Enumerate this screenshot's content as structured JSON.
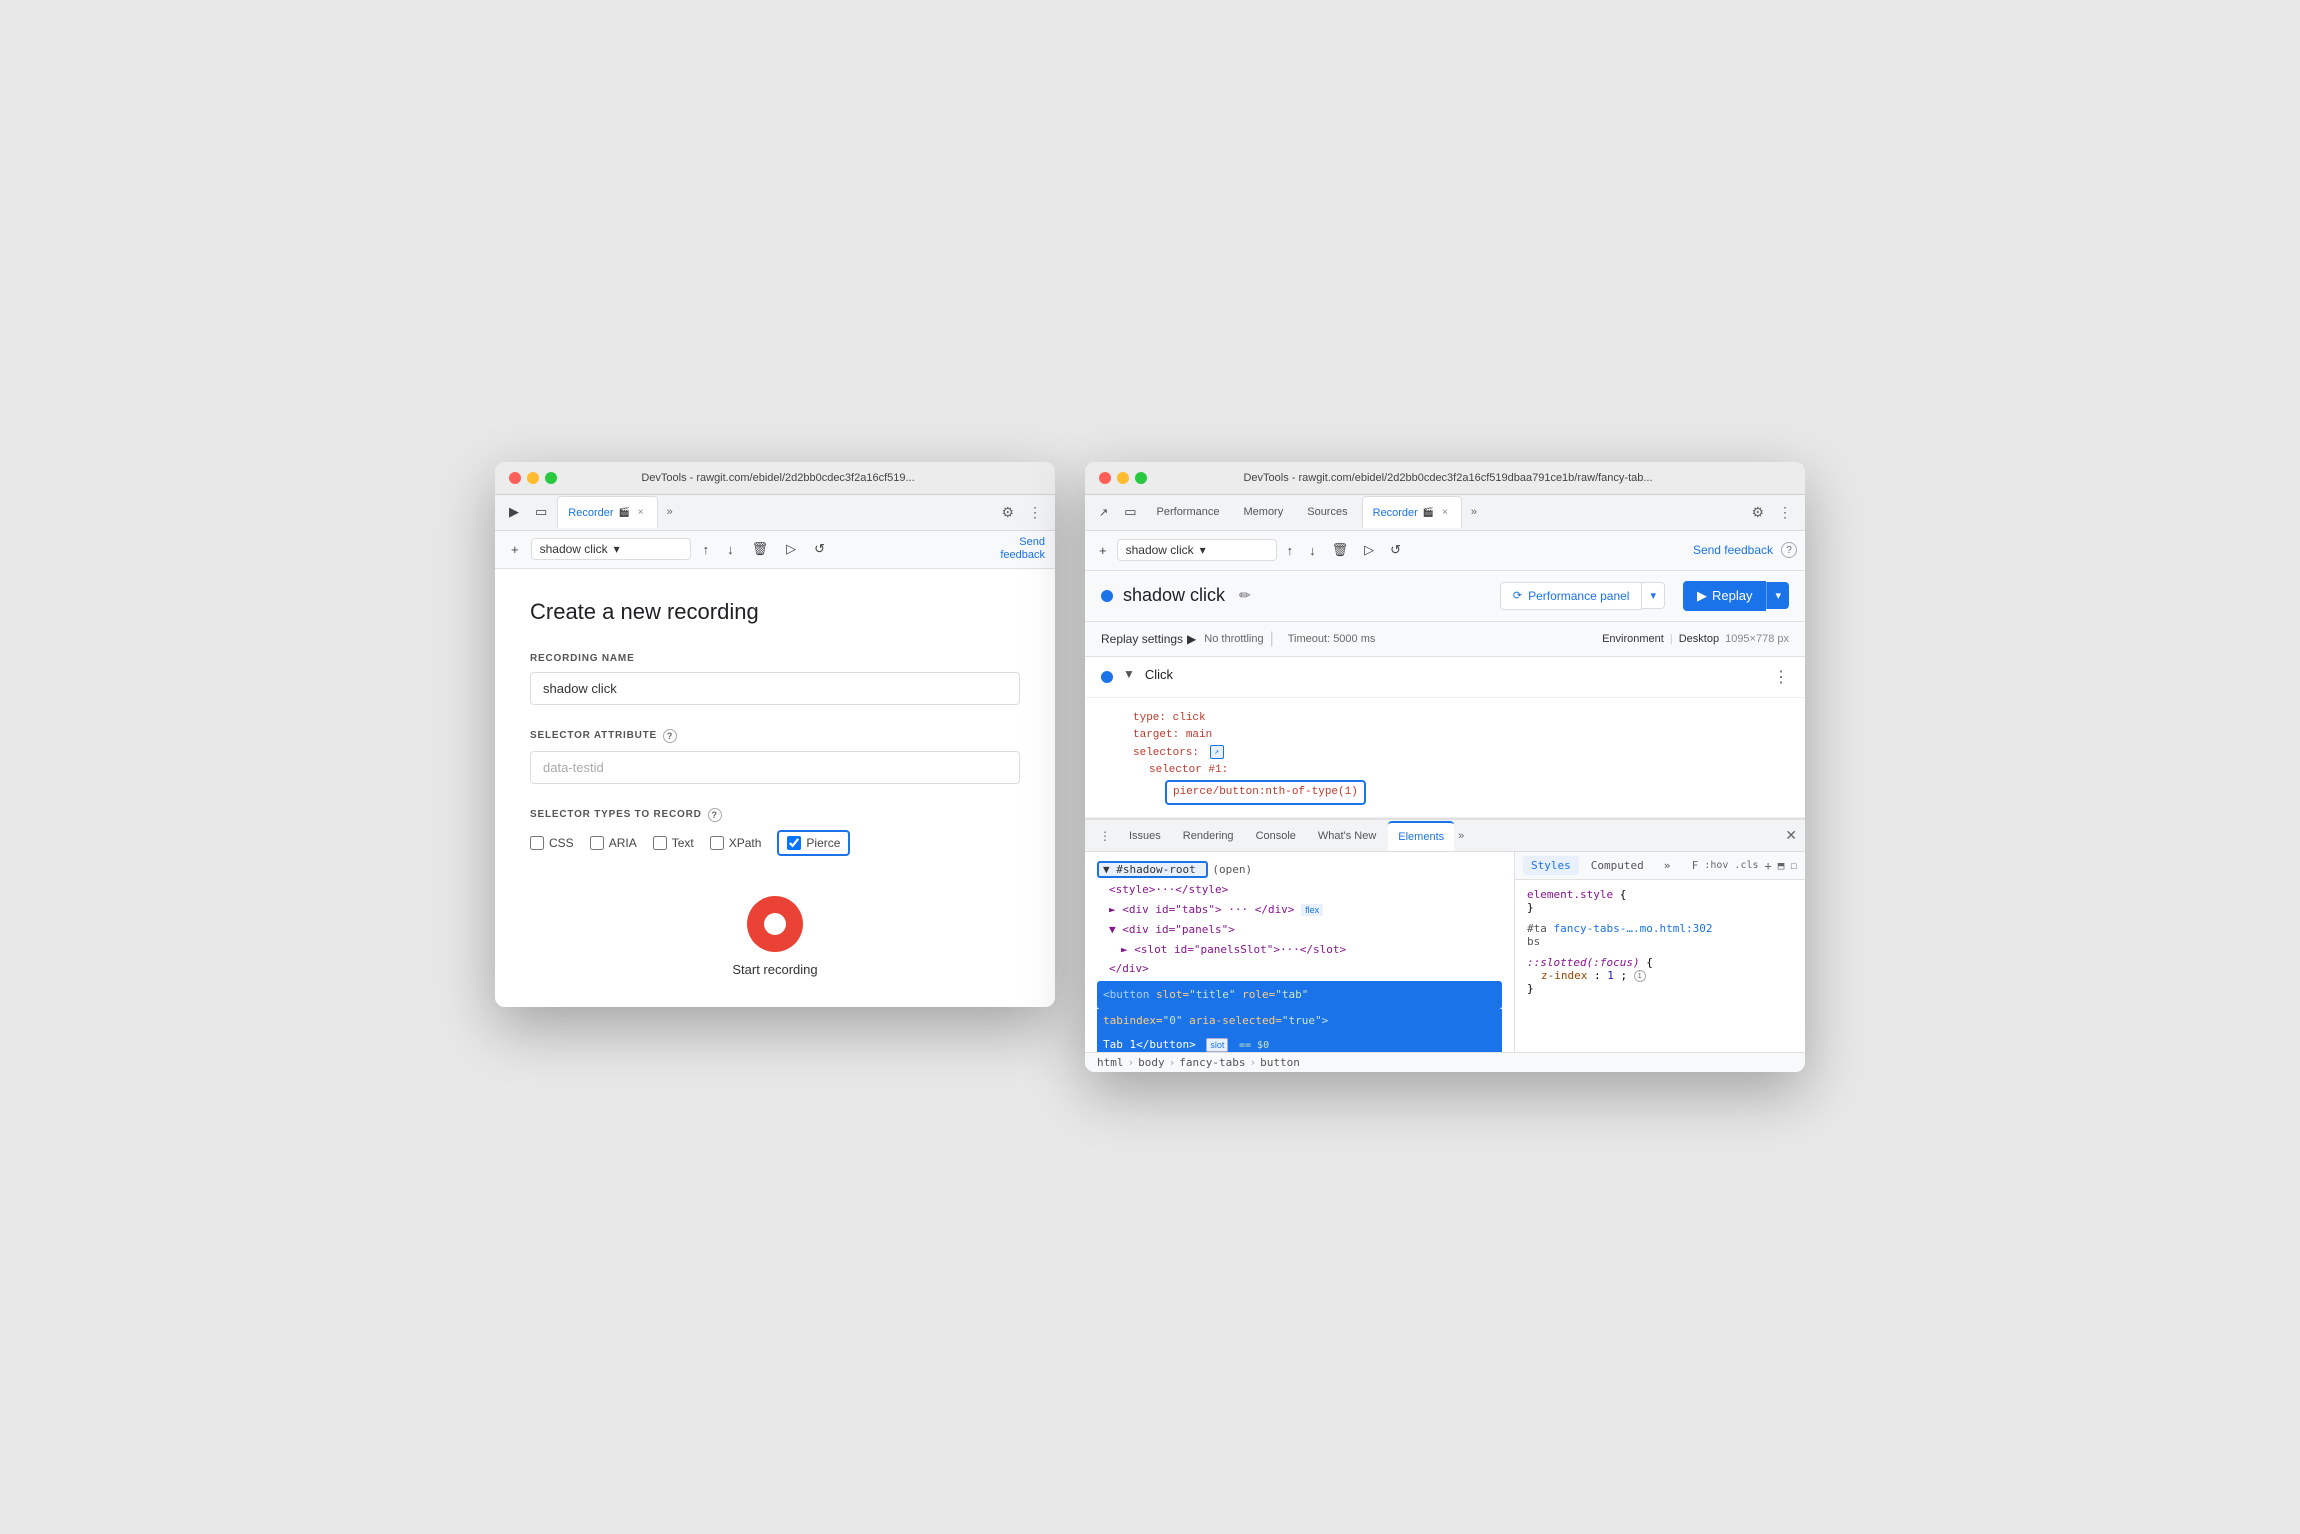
{
  "left_window": {
    "title": "DevTools - rawgit.com/ebidel/2d2bb0cdec3f2a16cf519...",
    "tab_label": "Recorder",
    "tab_close": "×",
    "toolbar": {
      "new_btn": "+",
      "recording_name": "shadow click",
      "more_btn": "»",
      "feedback": "Send\nfeedback"
    },
    "create_panel": {
      "title": "Create a new recording",
      "recording_name_label": "RECORDING NAME",
      "recording_name_value": "shadow click",
      "selector_attr_label": "SELECTOR ATTRIBUTE",
      "selector_attr_placeholder": "data-testid",
      "selector_types_label": "SELECTOR TYPES TO RECORD",
      "checkboxes": [
        {
          "label": "CSS",
          "checked": false
        },
        {
          "label": "ARIA",
          "checked": false
        },
        {
          "label": "Text",
          "checked": false
        },
        {
          "label": "XPath",
          "checked": false
        },
        {
          "label": "Pierce",
          "checked": true,
          "highlighted": true
        }
      ],
      "start_btn_label": "Start recording"
    }
  },
  "right_window": {
    "title": "DevTools - rawgit.com/ebidel/2d2bb0cdec3f2a16cf519dbaa791ce1b/raw/fancy-tab...",
    "tabs": [
      {
        "label": "Performance",
        "active": false
      },
      {
        "label": "Memory",
        "active": false
      },
      {
        "label": "Sources",
        "active": false
      },
      {
        "label": "Recorder",
        "active": true
      },
      {
        "label": "»",
        "active": false
      }
    ],
    "toolbar": {
      "new_btn": "+",
      "recording_name": "shadow click",
      "feedback_label": "Send feedback",
      "help_icon": "?"
    },
    "recorder_header": {
      "recording_title": "shadow click",
      "edit_icon": "✏",
      "perf_panel_btn": "Performance panel",
      "replay_btn": "Replay"
    },
    "replay_settings": {
      "label": "Replay settings",
      "arrow": "▶",
      "no_throttling": "No throttling",
      "timeout": "Timeout: 5000 ms",
      "env_label": "Environment",
      "env_value": "Desktop",
      "env_resolution": "1095×778 px"
    },
    "step": {
      "label": "Click",
      "code": {
        "type_key": "type:",
        "type_val": "click",
        "target_key": "target:",
        "target_val": "main",
        "selectors_key": "selectors:",
        "selector_num_label": "selector #1:",
        "selector_val": "pierce/button:nth-of-type(1)"
      }
    },
    "bottom_tabs": [
      {
        "label": "Issues",
        "active": false
      },
      {
        "label": "Rendering",
        "active": false
      },
      {
        "label": "Console",
        "active": false
      },
      {
        "label": "What's New",
        "active": false
      },
      {
        "label": "Elements",
        "active": true
      }
    ],
    "elements": {
      "shadow_root_label": "▼ #shadow-root",
      "shadow_root_open": "(open)",
      "style_line": "<style>···</style>",
      "div_tabs": "<div id=\"tabs\"> ··· </div>",
      "flex_badge": "flex",
      "div_panels": "▼ <div id=\"panels\">",
      "slot_line": "► <slot id=\"panelsSlot\">···</slot>",
      "div_close": "</div>",
      "button_line_1": "<button slot=\"title\" role=\"tab\"",
      "button_line_2": "tabindex=\"0\" aria-selected=\"true\">",
      "button_line_3": "Tab 1</button>",
      "slot_badge": "slot",
      "equals_badge": "== $0",
      "breadcrumb": [
        "html",
        "body",
        "fancy-tabs",
        "button"
      ]
    },
    "styles": {
      "tabs": [
        "Styles",
        "Computed",
        "»"
      ],
      "active_tab": "Styles",
      "filter_label": "F",
      "filter_hov": ":hov",
      "filter_cls": ".cls",
      "filter_plus": "+",
      "element_style_label": "element.style {",
      "element_style_close": "}",
      "file_ref": "#ta",
      "file_link": "fancy-tabs-….mo.html:302",
      "file_suffix": "bs",
      "slotted_rule": "::slotted(:focus) {",
      "slotted_prop": "z-index:",
      "slotted_val": "1;",
      "info_icon": "i",
      "slotted_close": "}"
    }
  }
}
